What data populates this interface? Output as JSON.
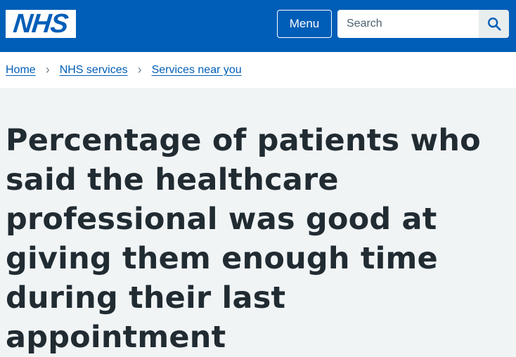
{
  "header": {
    "logo_text": "NHS",
    "menu_label": "Menu",
    "search_placeholder": "Search",
    "search_icon": "search-icon"
  },
  "breadcrumb": {
    "items": [
      {
        "label": "Home"
      },
      {
        "label": "NHS services"
      },
      {
        "label": "Services near you"
      }
    ],
    "separator_icon": "chevron-right-icon"
  },
  "main": {
    "title": "Percentage of patients who said the healthcare professional was good at giving them enough time during their last appointment"
  },
  "colors": {
    "header_bg": "#005eb8",
    "page_bg": "#f0f4f5",
    "link": "#005eb8",
    "text": "#212b32"
  }
}
